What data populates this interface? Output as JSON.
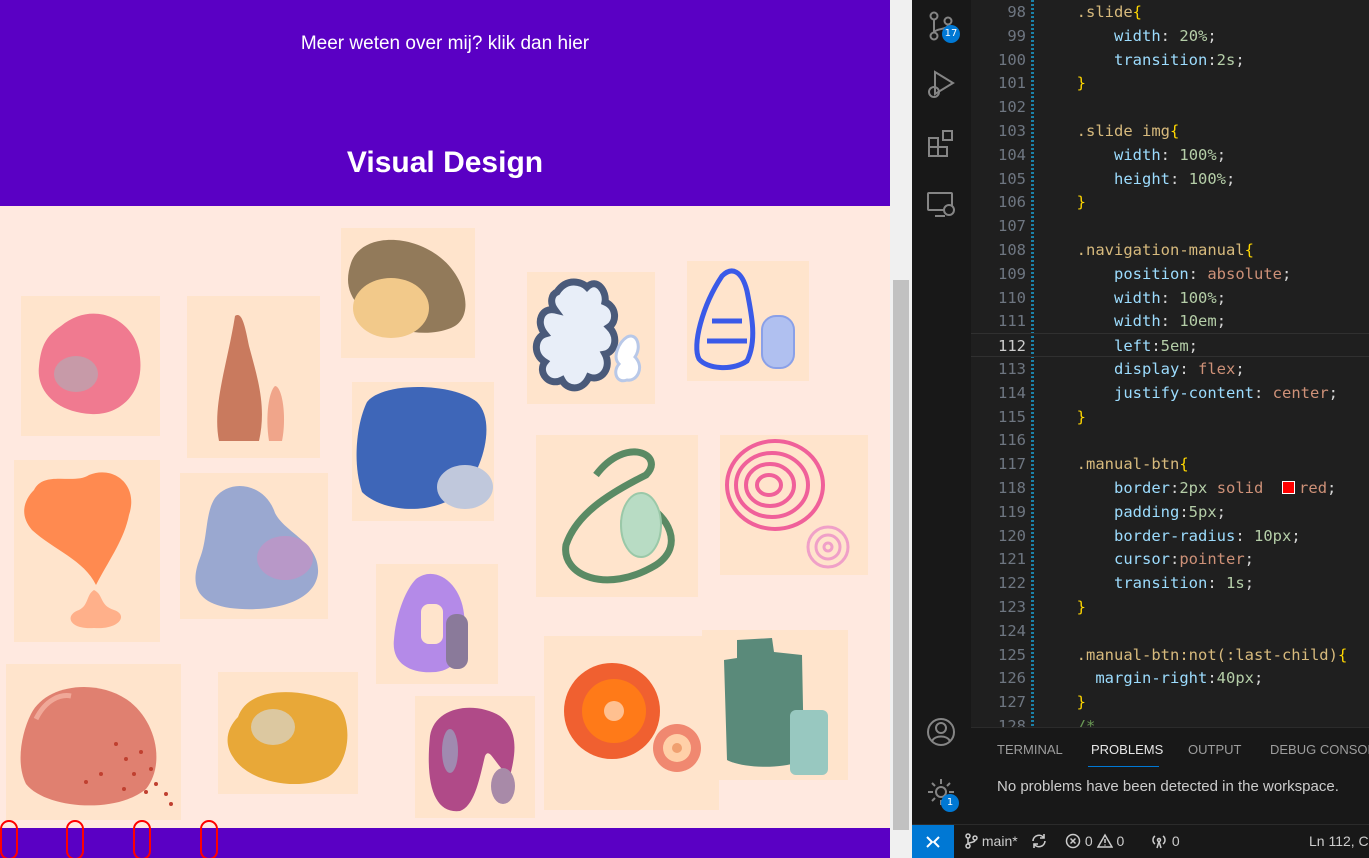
{
  "preview": {
    "about_link": "Meer weten over mij? klik dan hier",
    "hero_title": "Visual Design",
    "colors": {
      "header": "#5a00c4",
      "background": "#ffe9e0",
      "tile": "#ffe4cc",
      "manual_btn_border": "#ff0000"
    },
    "gallery_icons": [
      "pink-blob-icon",
      "terracotta-vase-icon",
      "brown-stone-icon",
      "white-coral-icon",
      "blue-bell-icon",
      "blue-square-blob-icon",
      "green-loop-icon",
      "pink-swirl-icon",
      "orange-tree-icon",
      "lavender-blob-icon",
      "purple-arch-icon",
      "salmon-blob-icon",
      "yellow-ring-icon",
      "magenta-hook-icon",
      "orange-circle-icon",
      "teal-block-icon"
    ]
  },
  "editor": {
    "current_line": "112",
    "lines": [
      {
        "n": "98",
        "code": "  .slide{"
      },
      {
        "n": "99",
        "code": "      width: 20%;"
      },
      {
        "n": "100",
        "code": "      transition:2s;"
      },
      {
        "n": "101",
        "code": "  }"
      },
      {
        "n": "102",
        "code": ""
      },
      {
        "n": "103",
        "code": "  .slide img{"
      },
      {
        "n": "104",
        "code": "      width: 100%;"
      },
      {
        "n": "105",
        "code": "      height: 100%;"
      },
      {
        "n": "106",
        "code": "  }"
      },
      {
        "n": "107",
        "code": ""
      },
      {
        "n": "108",
        "code": "  .navigation-manual{"
      },
      {
        "n": "109",
        "code": "      position: absolute;"
      },
      {
        "n": "110",
        "code": "      width: 100%;"
      },
      {
        "n": "111",
        "code": "      width: 10em;"
      },
      {
        "n": "112",
        "code": "      left:5em;"
      },
      {
        "n": "113",
        "code": "      display: flex;"
      },
      {
        "n": "114",
        "code": "      justify-content: center;"
      },
      {
        "n": "115",
        "code": "  }"
      },
      {
        "n": "116",
        "code": ""
      },
      {
        "n": "117",
        "code": "  .manual-btn{"
      },
      {
        "n": "118",
        "code": "      border:2px solid  red;"
      },
      {
        "n": "119",
        "code": "      padding:5px;"
      },
      {
        "n": "120",
        "code": "      border-radius: 10px;"
      },
      {
        "n": "121",
        "code": "      cursor:pointer;"
      },
      {
        "n": "122",
        "code": "      transition: 1s;"
      },
      {
        "n": "123",
        "code": "  }"
      },
      {
        "n": "124",
        "code": ""
      },
      {
        "n": "125",
        "code": "  .manual-btn:not(:last-child){"
      },
      {
        "n": "126",
        "code": "    margin-right:40px;"
      },
      {
        "n": "127",
        "code": "  }"
      },
      {
        "n": "128",
        "code": "  /*"
      }
    ]
  },
  "activity_bar": {
    "source_control_badge": "17",
    "settings_badge": "1"
  },
  "panel": {
    "tabs": [
      "TERMINAL",
      "PROBLEMS",
      "OUTPUT",
      "DEBUG CONSOLE"
    ],
    "active_tab": "PROBLEMS",
    "message": "No problems have been detected in the workspace."
  },
  "status_bar": {
    "branch": "main*",
    "errors": "0",
    "warnings": "0",
    "ports": "0",
    "position": "Ln 112, C"
  }
}
